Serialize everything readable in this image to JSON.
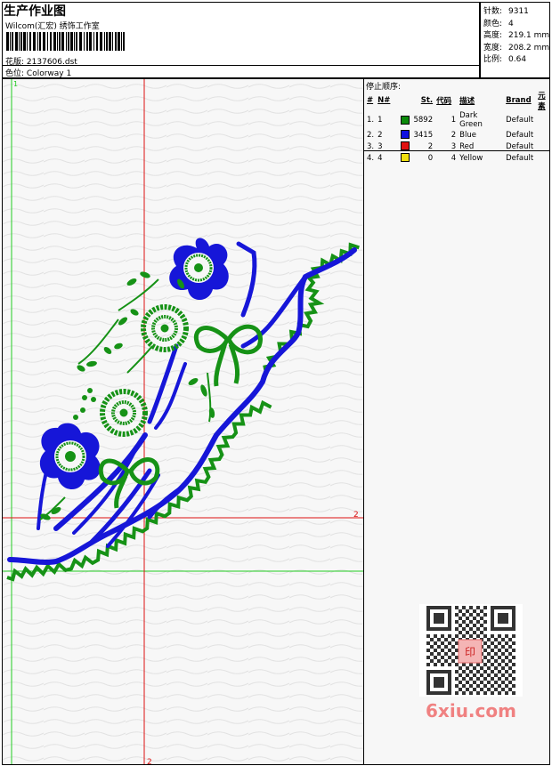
{
  "header": {
    "title": "生产作业图",
    "company": "Wilcom(汇宏) 绣饰工作室",
    "design_label": "花版:",
    "design_file": "2137606.dst",
    "color_label": "色位:",
    "colorway": "Colorway 1"
  },
  "stats": [
    {
      "label": "针数:",
      "value": "9311"
    },
    {
      "label": "颜色:",
      "value": "4"
    },
    {
      "label": "高度:",
      "value": "219.1 mm"
    },
    {
      "label": "宽度:",
      "value": "208.2 mm"
    },
    {
      "label": "比例:",
      "value": "0.64"
    }
  ],
  "guides": {
    "left_marker": "1",
    "horizontal_marker": "2",
    "vertical_marker": "2"
  },
  "stop_sequence": {
    "title": "停止顺序:",
    "columns": [
      "#",
      "N#",
      "St.",
      "代码",
      "描述",
      "Brand",
      "元素"
    ],
    "rows": [
      {
        "num": "1.",
        "n": "1",
        "color": "#0a8a0a",
        "st": "5892",
        "code": "1",
        "desc": "Dark Green",
        "brand": "Default"
      },
      {
        "num": "2.",
        "n": "2",
        "color": "#1010e0",
        "st": "3415",
        "code": "2",
        "desc": "Blue",
        "brand": "Default"
      },
      {
        "num": "3.",
        "n": "3",
        "color": "#e01010",
        "st": "2",
        "code": "3",
        "desc": "Red",
        "brand": "Default"
      },
      {
        "num": "4.",
        "n": "4",
        "color": "#f0e010",
        "st": "0",
        "code": "4",
        "desc": "Yellow",
        "brand": "Default"
      }
    ]
  },
  "colors": {
    "green": "#169216",
    "blue": "#1616d8",
    "guide_red": "#dd1111",
    "guide_green": "#22cc22"
  },
  "watermark": {
    "text": "6xiu.com",
    "seal": "印"
  }
}
